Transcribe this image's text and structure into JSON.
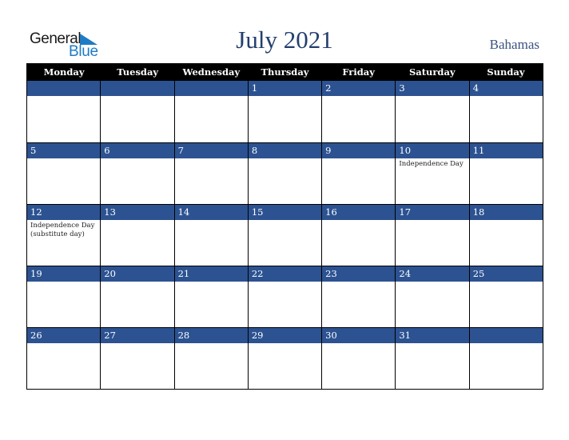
{
  "logo": {
    "word1": "General",
    "word2": "Blue"
  },
  "header": {
    "title": "July 2021",
    "country": "Bahamas"
  },
  "colors": {
    "band": "#2c5291",
    "title": "#233e6e",
    "header_bg": "#000000"
  },
  "weekdays": [
    "Monday",
    "Tuesday",
    "Wednesday",
    "Thursday",
    "Friday",
    "Saturday",
    "Sunday"
  ],
  "weeks": [
    [
      {
        "d": ""
      },
      {
        "d": ""
      },
      {
        "d": ""
      },
      {
        "d": "1"
      },
      {
        "d": "2"
      },
      {
        "d": "3"
      },
      {
        "d": "4"
      }
    ],
    [
      {
        "d": "5"
      },
      {
        "d": "6"
      },
      {
        "d": "7"
      },
      {
        "d": "8"
      },
      {
        "d": "9"
      },
      {
        "d": "10",
        "e": "Independence Day"
      },
      {
        "d": "11"
      }
    ],
    [
      {
        "d": "12",
        "e": "Independence Day (substitute day)"
      },
      {
        "d": "13"
      },
      {
        "d": "14"
      },
      {
        "d": "15"
      },
      {
        "d": "16"
      },
      {
        "d": "17"
      },
      {
        "d": "18"
      }
    ],
    [
      {
        "d": "19"
      },
      {
        "d": "20"
      },
      {
        "d": "21"
      },
      {
        "d": "22"
      },
      {
        "d": "23"
      },
      {
        "d": "24"
      },
      {
        "d": "25"
      }
    ],
    [
      {
        "d": "26"
      },
      {
        "d": "27"
      },
      {
        "d": "28"
      },
      {
        "d": "29"
      },
      {
        "d": "30"
      },
      {
        "d": "31"
      },
      {
        "d": ""
      }
    ]
  ]
}
